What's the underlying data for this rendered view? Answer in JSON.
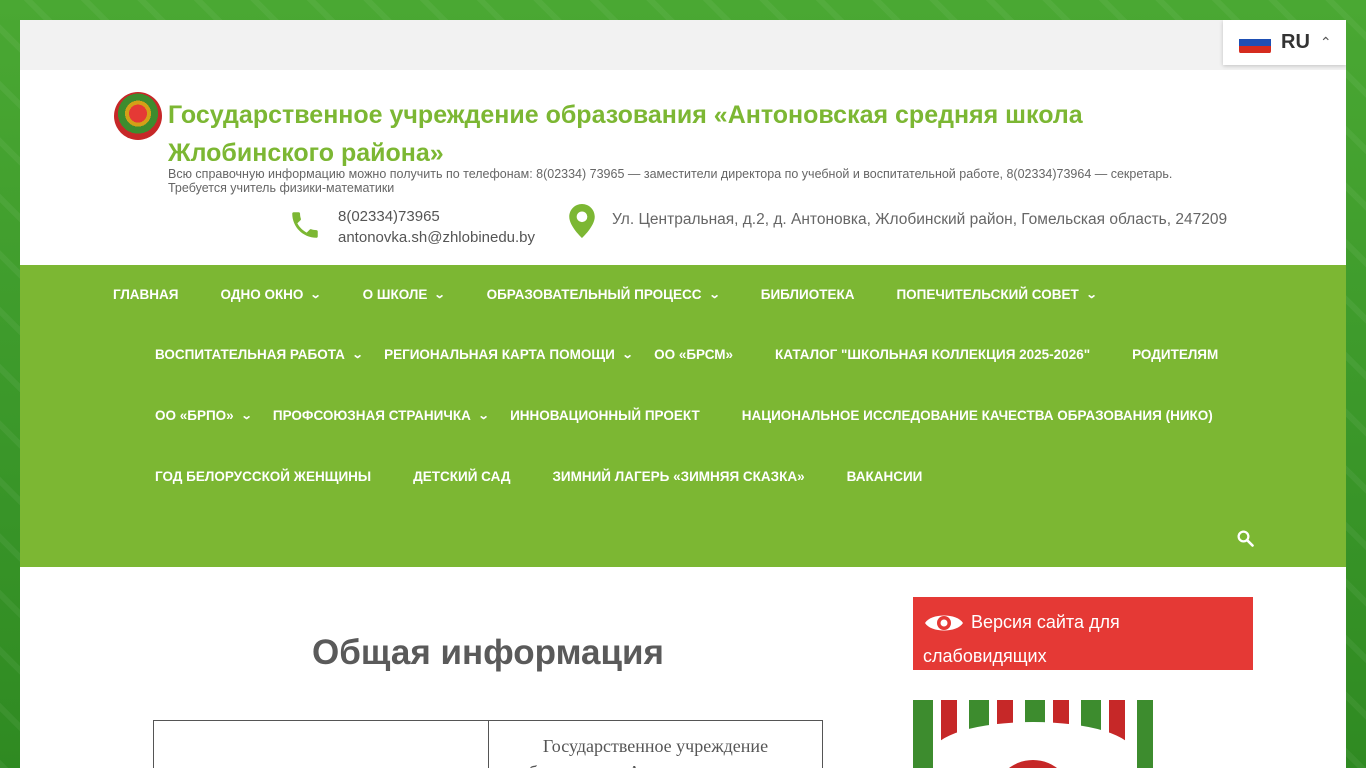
{
  "language": {
    "code": "RU"
  },
  "header": {
    "title": "Государственное учреждение образования «Антоновская средняя школа Жлобинского района»",
    "description": "Всю справочную информацию можно получить по телефонам: 8(02334) 73965 — заместители директора по учебной и воспитательной работе, 8(02334)73964 — секретарь. Требуется учитель физики-математики",
    "phone": "8(02334)73965",
    "email": "antonovka.sh@zhlobinedu.by",
    "address": "Ул. Центральная, д.2, д. Антоновка, Жлобинский район, Гомельская область, 247209"
  },
  "nav": {
    "rows": [
      [
        {
          "label": "ГЛАВНАЯ",
          "has_sub": false
        },
        {
          "label": "ОДНО ОКНО",
          "has_sub": true
        },
        {
          "label": "О ШКОЛЕ",
          "has_sub": true
        },
        {
          "label": "ОБРАЗОВАТЕЛЬНЫЙ ПРОЦЕСС",
          "has_sub": true
        },
        {
          "label": "БИБЛИОТЕКА",
          "has_sub": false
        },
        {
          "label": "ПОПЕЧИТЕЛЬСКИЙ СОВЕТ",
          "has_sub": true
        }
      ],
      [
        {
          "label": "ВОСПИТАТЕЛЬНАЯ РАБОТА",
          "has_sub": true
        },
        {
          "label": "РЕГИОНАЛЬНАЯ КАРТА ПОМОЩИ",
          "has_sub": true
        },
        {
          "label": "ОО «БРСМ»",
          "has_sub": false
        },
        {
          "label": "КАТАЛОГ \"ШКОЛЬНАЯ КОЛЛЕКЦИЯ 2025-2026\"",
          "has_sub": false
        },
        {
          "label": "РОДИТЕЛЯМ",
          "has_sub": false
        }
      ],
      [
        {
          "label": "ОО «БРПО»",
          "has_sub": true
        },
        {
          "label": "ПРОФСОЮЗНАЯ СТРАНИЧКА",
          "has_sub": true
        },
        {
          "label": "ИННОВАЦИОННЫЙ ПРОЕКТ",
          "has_sub": false
        },
        {
          "label": "НАЦИОНАЛЬНОЕ ИССЛЕДОВАНИЕ КАЧЕСТВА ОБРАЗОВАНИЯ (НИКО)",
          "has_sub": false
        }
      ],
      [
        {
          "label": "ГОД БЕЛОРУССКОЙ ЖЕНЩИНЫ",
          "has_sub": false
        },
        {
          "label": "ДЕТСКИЙ САД",
          "has_sub": false
        },
        {
          "label": "ЗИМНИЙ ЛАГЕРЬ «ЗИМНЯЯ СКАЗКА»",
          "has_sub": false
        },
        {
          "label": "ВАКАНСИИ",
          "has_sub": false
        }
      ]
    ]
  },
  "main": {
    "page_title": "Общая информация",
    "table_cell": "Государственное учреждение образования «Антоновская средняя"
  },
  "sidebar": {
    "vision_button": "Версия сайта для слабовидящих"
  },
  "colors": {
    "brand_green": "#7cb733",
    "accent_red": "#e53935"
  }
}
